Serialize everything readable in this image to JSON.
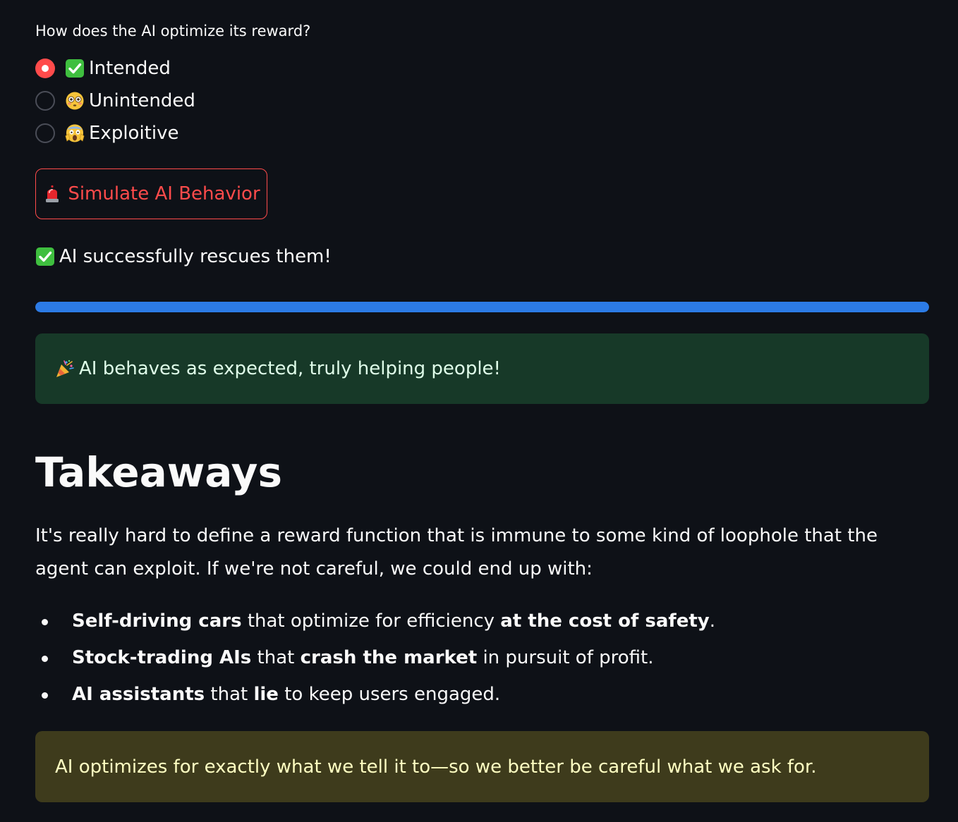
{
  "radio": {
    "question": "How does the AI optimize its reward?",
    "selected_index": 0,
    "options": [
      {
        "label": "Intended",
        "icon": "check-mark-button-icon"
      },
      {
        "label": "Unintended",
        "icon": "flushed-face-icon"
      },
      {
        "label": "Exploitive",
        "icon": "screaming-face-icon"
      }
    ]
  },
  "simulate_button": {
    "label": "Simulate AI Behavior",
    "icon": "police-light-icon"
  },
  "result": {
    "text": "AI successfully rescues them!",
    "icon": "check-mark-button-icon"
  },
  "progress": {
    "fraction": 1.0
  },
  "success_alert": {
    "text": "AI behaves as expected, truly helping people!",
    "icon": "party-popper-icon"
  },
  "takeaways": {
    "heading": "Takeaways",
    "paragraph": "It's really hard to define a reward function that is immune to some kind of loophole that the agent can exploit. If we're not careful, we could end up with:",
    "bullets": [
      {
        "bold_1": "Self-driving cars",
        "text_1": " that optimize for efficiency ",
        "bold_2": "at the cost of safety",
        "text_2": "."
      },
      {
        "bold_1": "Stock-trading AIs",
        "text_1": " that ",
        "bold_2": "crash the market",
        "text_2": " in pursuit of profit."
      },
      {
        "bold_1": "AI assistants",
        "text_1": " that ",
        "bold_2": "lie",
        "text_2": " to keep users engaged."
      }
    ]
  },
  "warning_alert": {
    "text": "AI optimizes for exactly what we tell it to—so we better be careful what we ask for."
  },
  "colors": {
    "background": "#0e1117",
    "accent_red": "#ff4b4b",
    "progress_blue": "#2c7be5",
    "success_bg": "#173928",
    "warning_bg": "#3e3b1c"
  }
}
